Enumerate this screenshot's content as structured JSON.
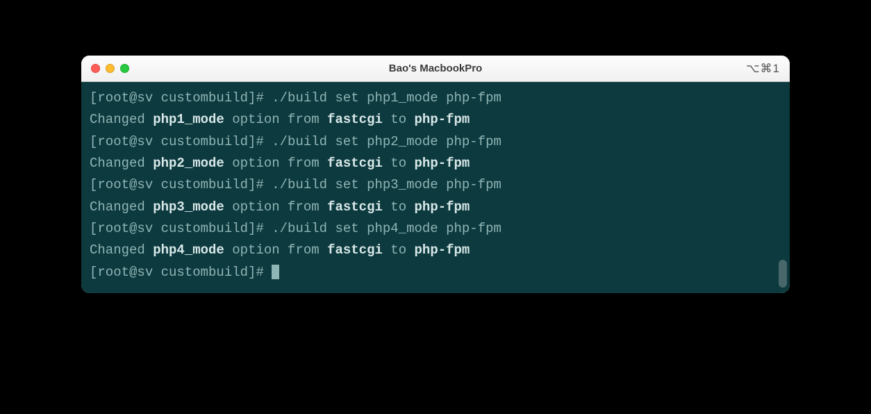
{
  "window": {
    "title": "Bao's MacbookPro",
    "shortcut": "⌥⌘1"
  },
  "terminal": {
    "prompt": "[root@sv custombuild]# ",
    "lines": [
      {
        "cmd": "./build set php1_mode php-fpm",
        "result_prefix": "Changed ",
        "option": "php1_mode",
        "mid1": " option from ",
        "from": "fastcgi",
        "mid2": " to ",
        "to": "php-fpm"
      },
      {
        "cmd": "./build set php2_mode php-fpm",
        "result_prefix": "Changed ",
        "option": "php2_mode",
        "mid1": " option from ",
        "from": "fastcgi",
        "mid2": " to ",
        "to": "php-fpm"
      },
      {
        "cmd": "./build set php3_mode php-fpm",
        "result_prefix": "Changed ",
        "option": "php3_mode",
        "mid1": " option from ",
        "from": "fastcgi",
        "mid2": " to ",
        "to": "php-fpm"
      },
      {
        "cmd": "./build set php4_mode php-fpm",
        "result_prefix": "Changed ",
        "option": "php4_mode",
        "mid1": " option from ",
        "from": "fastcgi",
        "mid2": " to ",
        "to": "php-fpm"
      }
    ]
  }
}
